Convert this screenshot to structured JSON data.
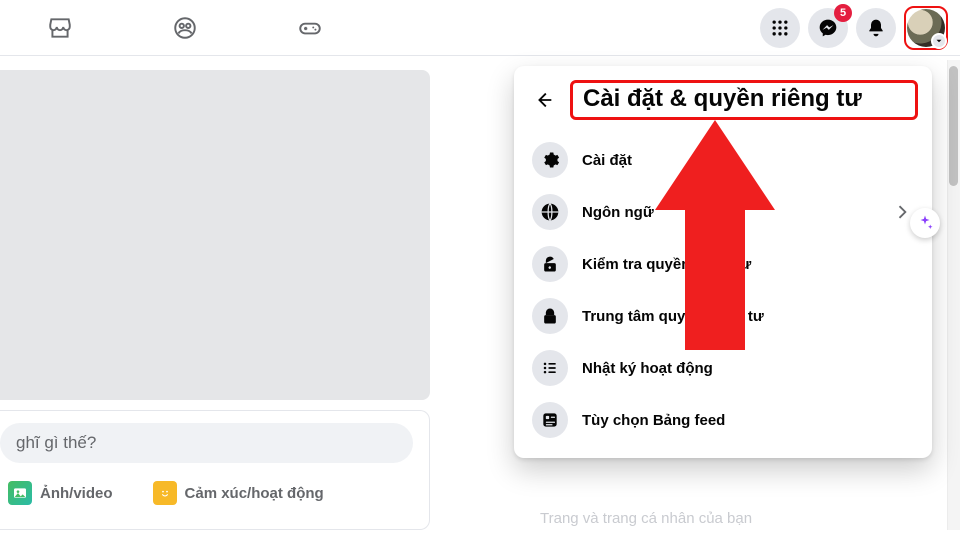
{
  "topbar": {
    "messenger_badge": "5"
  },
  "composer": {
    "placeholder": "ghĩ gì thế?",
    "photo_label": "Ảnh/video",
    "feeling_label": "Cảm xúc/hoạt động"
  },
  "panel": {
    "title": "Cài đặt & quyền riêng tư",
    "items": [
      {
        "label": "Cài đặt"
      },
      {
        "label": "Ngôn ngữ",
        "chevron": true
      },
      {
        "label": "Kiểm tra quyền riêng tư"
      },
      {
        "label": "Trung tâm quyền riêng tư"
      },
      {
        "label": "Nhật ký hoạt động"
      },
      {
        "label": "Tùy chọn Bảng feed"
      }
    ]
  },
  "background_text": "Trang và trang cá nhân của bạn",
  "annotation": {
    "highlight_color": "#e11",
    "arrow_color": "#ef1f1f"
  }
}
